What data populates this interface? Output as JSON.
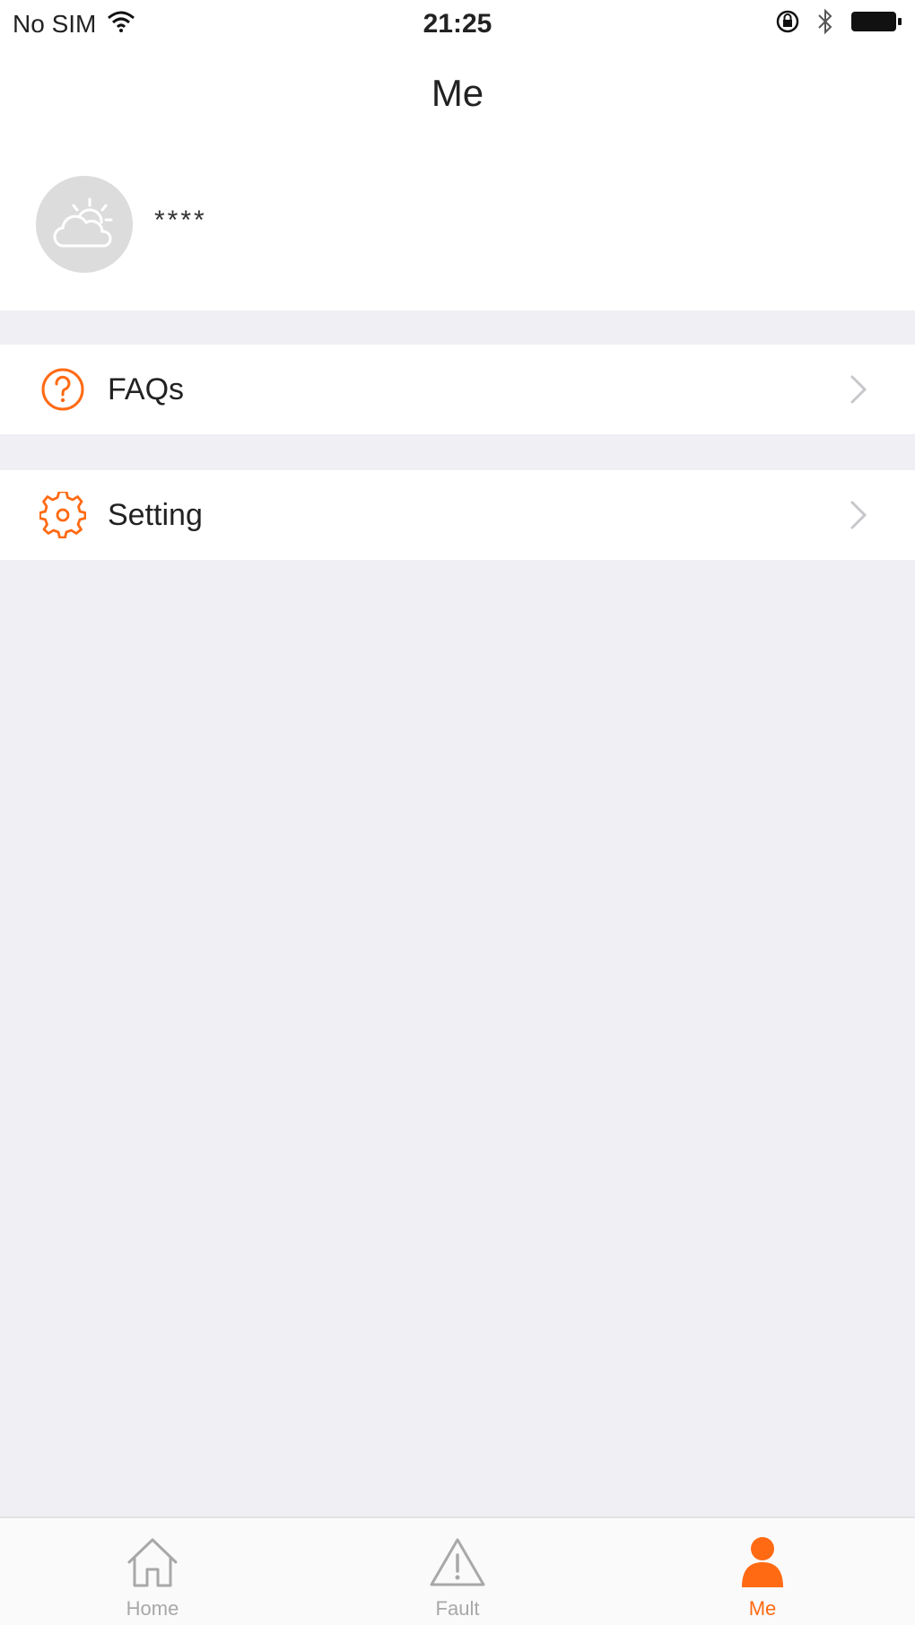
{
  "status_bar": {
    "carrier": "No SIM",
    "time": "21:25"
  },
  "nav": {
    "title": "Me"
  },
  "profile": {
    "username": "****"
  },
  "menu": [
    {
      "label": "FAQs",
      "icon": "question-icon"
    },
    {
      "label": "Setting",
      "icon": "gear-icon"
    }
  ],
  "tabs": [
    {
      "label": "Home",
      "icon": "home-icon",
      "active": false
    },
    {
      "label": "Fault",
      "icon": "warning-icon",
      "active": false
    },
    {
      "label": "Me",
      "icon": "person-icon",
      "active": true
    }
  ],
  "colors": {
    "accent": "#ff6a13",
    "background": "#efeff4",
    "inactive_tab": "#a8a8a8"
  }
}
